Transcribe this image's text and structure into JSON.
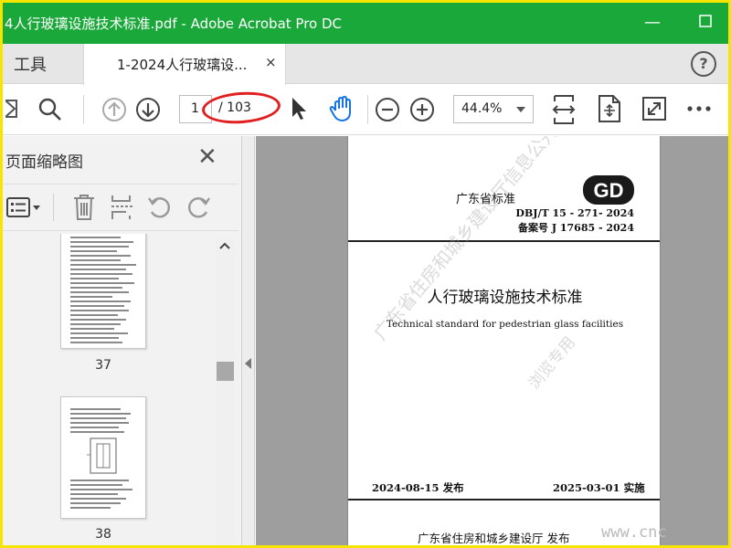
{
  "app": {
    "title": "4人行玻璃设施技术标准.pdf - Adobe Acrobat Pro DC",
    "watermark_logo": "",
    "window_buttons": {
      "minimize": "—",
      "maximize": "☐"
    }
  },
  "tabs": {
    "tools_label": "工具",
    "doc_label": "1-2024人行玻璃设...",
    "close_glyph": "×",
    "help_glyph": "?"
  },
  "toolbar": {
    "current_page": "1",
    "total_pages": "/ 103",
    "zoom": "44.4%"
  },
  "panel": {
    "title": "页面缩略图",
    "close_glyph": "✕",
    "thumbnails": [
      {
        "page": "37"
      },
      {
        "page": "38"
      }
    ]
  },
  "document": {
    "province": "广东省标准",
    "logo_text": "GD",
    "std_number": "DBJ/T 15 - 271- 2024",
    "record_number": "备案号 J 17685 - 2024",
    "title_cn": "人行玻璃设施技术标准",
    "title_en": "Technical standard for pedestrian glass facilities",
    "publish_date": "2024-08-15  发布",
    "implement_date": "2025-03-01  实施",
    "issuer": "广东省住房和城乡建设厅    发布",
    "watermark_line1": "广东省住房和城乡建设厅信息公开",
    "watermark_line2": "浏览专用"
  },
  "corner_watermark": "www.cnc",
  "colors": {
    "titlebar": "#1aa83a",
    "frame": "#f5e500",
    "hand_tool": "#1473e6",
    "annotation": "#e02020"
  }
}
